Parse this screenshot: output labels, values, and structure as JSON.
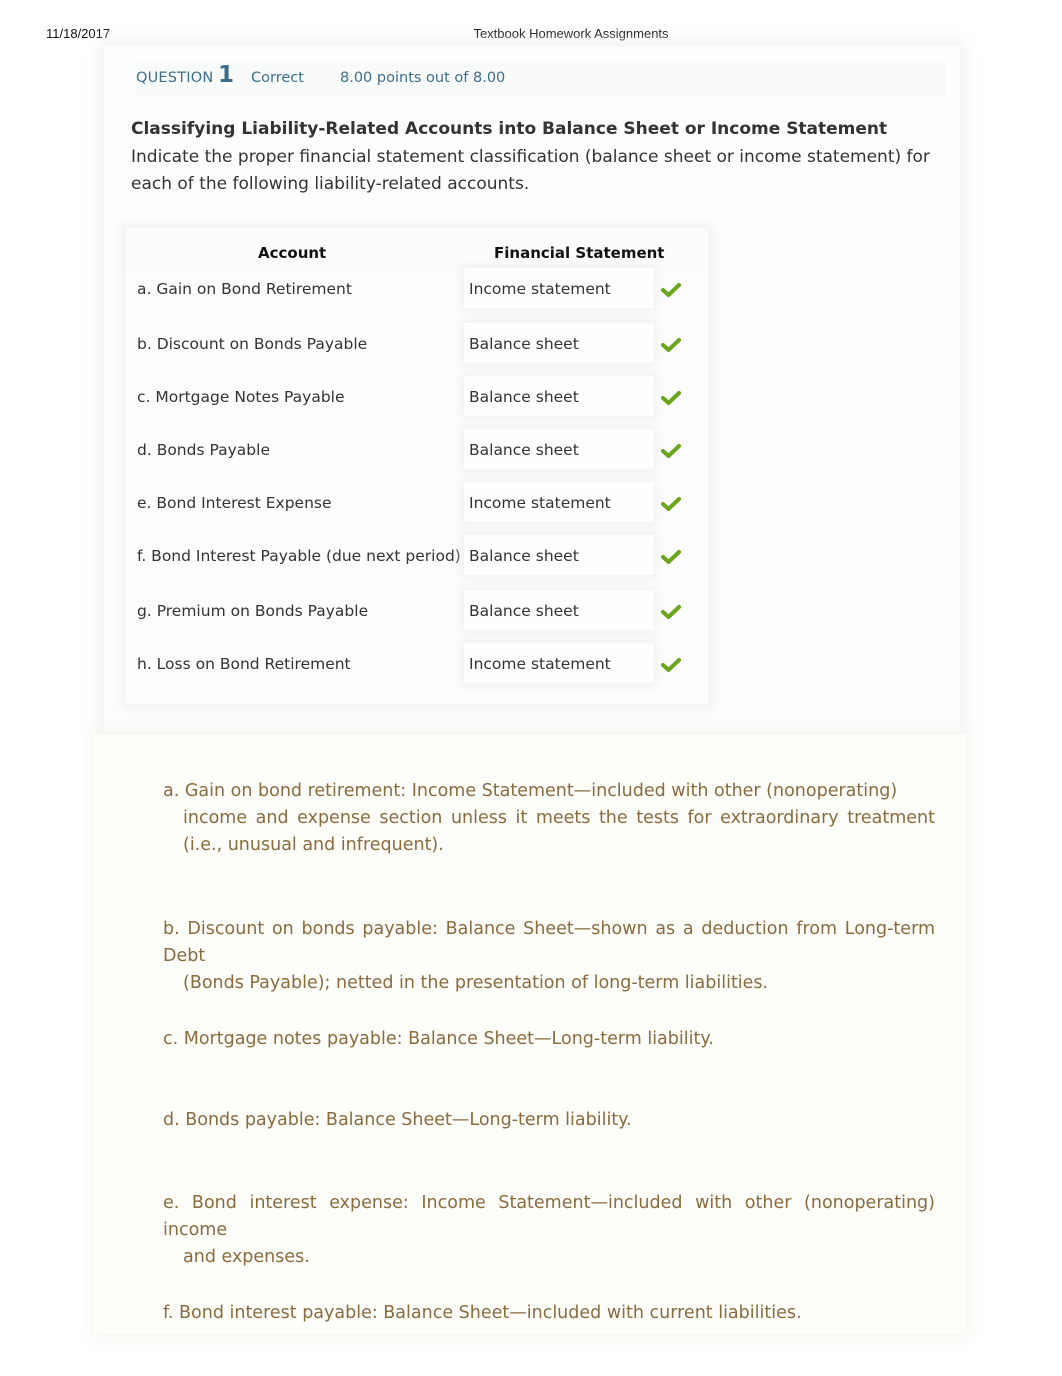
{
  "print_header": {
    "date": "11/18/2017",
    "title": "Textbook Homework Assignments"
  },
  "question": {
    "label": "QUESTION",
    "number": "1",
    "status": "Correct",
    "points": "8.00 points out of 8.00",
    "title": "Classifying Liability-Related Accounts into Balance Sheet or Income Statement",
    "description": "Indicate the proper financial statement classification (balance sheet or income statement) for each of the following liability-related accounts."
  },
  "table": {
    "headers": [
      "Account",
      "Financial Statement"
    ],
    "rows": [
      {
        "account": "a. Gain on Bond Retirement",
        "statement": "Income statement",
        "result": "correct"
      },
      {
        "account": "b. Discount on Bonds Payable",
        "statement": "Balance sheet",
        "result": "correct"
      },
      {
        "account": "c. Mortgage Notes Payable",
        "statement": "Balance sheet",
        "result": "correct"
      },
      {
        "account": "d. Bonds Payable",
        "statement": "Balance sheet",
        "result": "correct"
      },
      {
        "account": "e. Bond Interest Expense",
        "statement": "Income statement",
        "result": "correct"
      },
      {
        "account": "f. Bond Interest Payable (due next period)",
        "statement": "Balance sheet",
        "result": "correct"
      },
      {
        "account": "g. Premium on Bonds Payable",
        "statement": "Balance sheet",
        "result": "correct"
      },
      {
        "account": "h. Loss on Bond Retirement",
        "statement": "Income statement",
        "result": "correct"
      }
    ],
    "check_icon": "checkmark-icon",
    "check_color": "#6aa51c"
  },
  "explanations": [
    {
      "first": "a.  Gain  on  bond  retirement:  Income  Statement—included  with  other  (nonoperating)",
      "rest": "income and expense section unless it meets the tests for extraordinary treatment (i.e., unusual and infrequent)."
    },
    {
      "first": "b. Discount on bonds payable: Balance Sheet—shown as a deduction from Long-term Debt",
      "rest": "(Bonds Payable); netted in the presentation of long-term liabilities."
    },
    {
      "first": "c. Mortgage notes payable: Balance Sheet—Long-term liability.",
      "rest": ""
    },
    {
      "first": "d. Bonds payable: Balance Sheet—Long-term liability.",
      "rest": ""
    },
    {
      "first": "e. Bond interest expense: Income Statement—included with other (nonoperating) income",
      "rest": "and expenses."
    },
    {
      "first": "f. Bond interest payable: Balance Sheet—included with current liabilities.",
      "rest": ""
    }
  ],
  "colors": {
    "question_header": "#3d6d8a",
    "explanation_text": "#8a6b3e",
    "check": "#6aa51c"
  }
}
